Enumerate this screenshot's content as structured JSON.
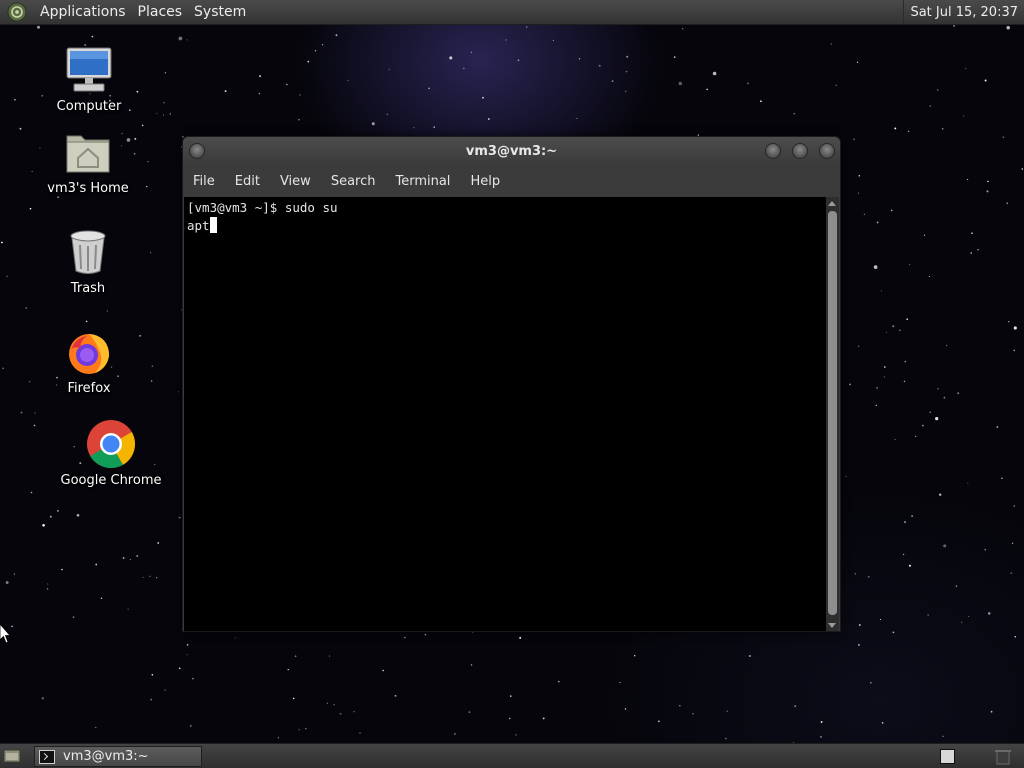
{
  "top_panel": {
    "menus": [
      "Applications",
      "Places",
      "System"
    ],
    "clock": "Sat Jul 15, 20:37"
  },
  "desktop_icons": [
    {
      "label": "Computer",
      "icon": "computer-icon"
    },
    {
      "label": "vm3's Home",
      "icon": "home-folder-icon"
    },
    {
      "label": "Trash",
      "icon": "trash-icon"
    },
    {
      "label": "Firefox",
      "icon": "firefox-icon"
    },
    {
      "label": "Google Chrome",
      "icon": "chrome-icon"
    }
  ],
  "window": {
    "title": "vm3@vm3:~",
    "menus": [
      "File",
      "Edit",
      "View",
      "Search",
      "Terminal",
      "Help"
    ],
    "terminal_lines": [
      "[vm3@vm3 ~]$ sudo su",
      "apt"
    ]
  },
  "bottom_panel": {
    "task_label": "vm3@vm3:~"
  },
  "colors": {
    "panel": "#3c3c3c",
    "terminal_bg": "#000000",
    "terminal_fg": "#e5e5e5"
  }
}
